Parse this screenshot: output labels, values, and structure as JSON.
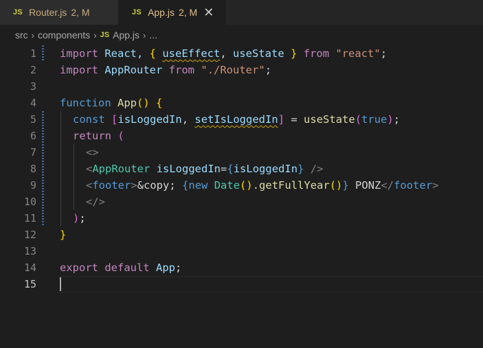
{
  "tabs": [
    {
      "badge": "JS",
      "name": "Router.js",
      "status": "2, M",
      "active": false
    },
    {
      "badge": "JS",
      "name": "App.js",
      "status": "2, M",
      "active": true,
      "close": "✕"
    }
  ],
  "breadcrumb": {
    "segments": [
      "src",
      "components",
      "App.js",
      "..."
    ],
    "file_badge": "JS",
    "separator": "›"
  },
  "editor": {
    "current_line": 15,
    "line_numbers": [
      "1",
      "2",
      "3",
      "4",
      "5",
      "6",
      "7",
      "8",
      "9",
      "10",
      "11",
      "12",
      "13",
      "14",
      "15"
    ],
    "tokens": {
      "l1": [
        "import",
        " React, ",
        "{",
        " ",
        "useEffect",
        ", ",
        "useState",
        " ",
        "}",
        " ",
        "from",
        " ",
        "\"react\"",
        ";"
      ],
      "l2": [
        "import",
        " ",
        "AppRouter",
        " ",
        "from",
        " ",
        "\"./Router\"",
        ";"
      ],
      "l4": [
        "function",
        " ",
        "App",
        "()",
        " ",
        "{"
      ],
      "l5": [
        "const",
        " ",
        "[",
        " ",
        "isLoggedIn",
        ", ",
        "setIsLoggedIn",
        "]",
        " = ",
        "useState",
        "(",
        "true",
        ")",
        ";"
      ],
      "l6": [
        "return",
        " ",
        "("
      ],
      "l7": [
        "<>"
      ],
      "l8": [
        "<",
        "AppRouter",
        " ",
        "isLoggedIn",
        "=",
        "{",
        "isLoggedIn",
        "}",
        " />"
      ],
      "l9": [
        "<",
        "footer",
        ">",
        "&copy; ",
        "{",
        "new",
        " ",
        "Date",
        "()",
        ".",
        "getFullYear",
        "()",
        "}",
        " PONZ",
        "</",
        "footer",
        ">"
      ],
      "l10": [
        "</>"
      ],
      "l11": [
        ")",
        ";"
      ],
      "l12": [
        "}"
      ],
      "l14": [
        "export",
        " ",
        "default",
        " ",
        "App",
        ";"
      ]
    }
  },
  "colors": {
    "background": "#1e1e1e",
    "tabbar": "#252526",
    "modified_tab_text": "#e2c08d",
    "js_icon": "#cbcb41",
    "keyword_purple": "#c586c0",
    "keyword_blue": "#569cd6",
    "variable": "#9cdcfe",
    "function": "#dcdcaa",
    "string": "#ce9178",
    "jsx_tag": "#4ec9b0",
    "warning_squiggle": "#cca700"
  }
}
